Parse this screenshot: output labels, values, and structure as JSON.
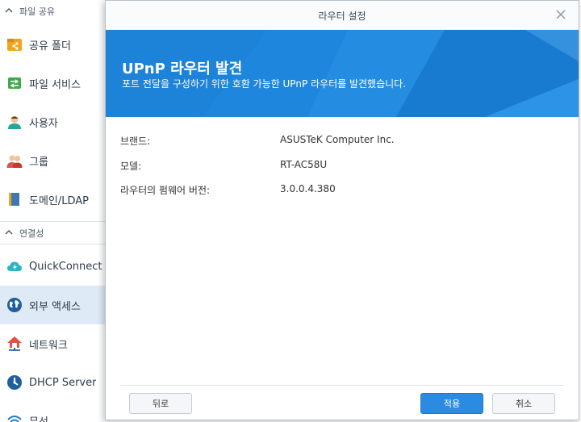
{
  "sidebar": {
    "section_file_sharing": "파일 공유",
    "section_connectivity": "연결성",
    "items": [
      {
        "label": "공유 폴더",
        "icon": "shared-folder-icon"
      },
      {
        "label": "파일 서비스",
        "icon": "file-services-icon"
      },
      {
        "label": "사용자",
        "icon": "user-icon"
      },
      {
        "label": "그룹",
        "icon": "group-icon"
      },
      {
        "label": "도메인/LDAP",
        "icon": "domain-ldap-icon"
      },
      {
        "label": "QuickConnect",
        "icon": "quickconnect-icon"
      },
      {
        "label": "외부 액세스",
        "icon": "external-access-icon"
      },
      {
        "label": "네트워크",
        "icon": "network-icon"
      },
      {
        "label": "DHCP Server",
        "icon": "dhcp-server-icon"
      },
      {
        "label": "무선",
        "icon": "wireless-icon"
      }
    ]
  },
  "dialog": {
    "title": "라우터 설정",
    "banner_title": "UPnP 라우터 발견",
    "banner_subtitle": "포트 전달을 구성하기 위한 호환 가능한 UPnP 라우터를 발견했습니다.",
    "rows": [
      {
        "key": "브랜드:",
        "value": "ASUSTeK Computer Inc."
      },
      {
        "key": "모델:",
        "value": "RT-AC58U"
      },
      {
        "key": "라우터의 펌웨어 버전:",
        "value": "3.0.0.4.380"
      }
    ],
    "buttons": {
      "back": "뒤로",
      "apply": "적용",
      "cancel": "취소"
    }
  },
  "colors": {
    "accent": "#1e86dc",
    "primary_button": "#2b8be0",
    "active_item": "#dfeaf7"
  }
}
